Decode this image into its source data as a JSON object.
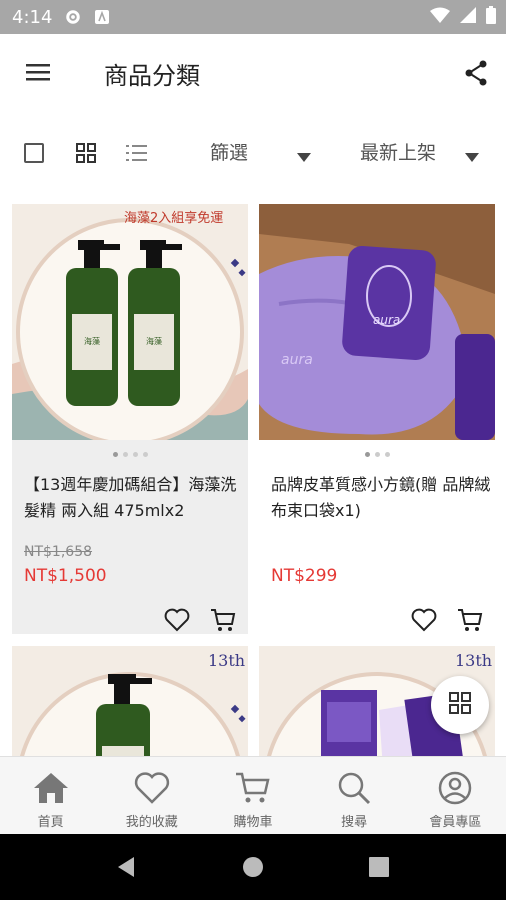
{
  "status_bar": {
    "time": "4:14"
  },
  "header": {
    "title": "商品分類"
  },
  "toolbar": {
    "filter_label": "篩選",
    "sort_label": "最新上架"
  },
  "products": [
    {
      "name": "【13週年慶加碼組合】海藻洗髮精 兩入組  475mlx2",
      "original_price": "NT$1,658",
      "price": "NT$1,500",
      "banner": "海藻2入組享免運",
      "bottle_label": "海藻"
    },
    {
      "name": "品牌皮革質感小方鏡(贈 品牌絨布束口袋x1)",
      "original_price": "",
      "price": "NT$299",
      "brand_text": "aura"
    },
    {
      "badge": "13th"
    },
    {
      "badge": "13th"
    }
  ],
  "bottom_nav": {
    "items": [
      {
        "label": "首頁",
        "icon": "home-icon"
      },
      {
        "label": "我的收藏",
        "icon": "heart-icon"
      },
      {
        "label": "購物車",
        "icon": "cart-icon"
      },
      {
        "label": "搜尋",
        "icon": "search-icon"
      },
      {
        "label": "會員專區",
        "icon": "user-icon"
      }
    ]
  },
  "colors": {
    "accent": "#e53935",
    "status_bar": "#a7a7a7",
    "card_bg": "#eeeeee"
  }
}
